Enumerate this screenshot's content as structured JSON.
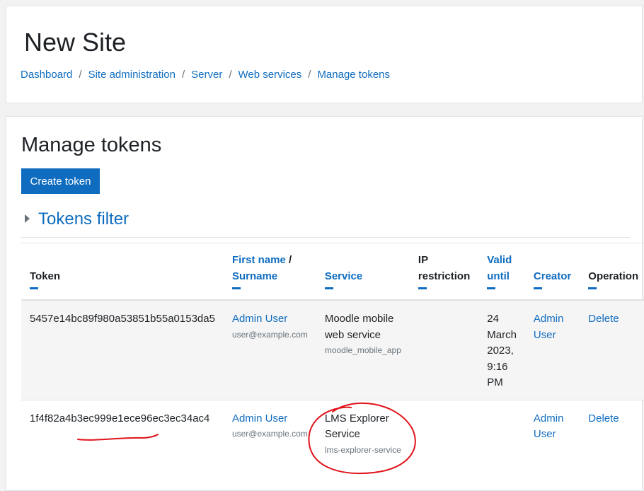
{
  "header": {
    "site_title": "New Site",
    "breadcrumb": [
      "Dashboard",
      "Site administration",
      "Server",
      "Web services",
      "Manage tokens"
    ]
  },
  "main": {
    "heading": "Manage tokens",
    "create_button": "Create token",
    "filter_title": "Tokens filter"
  },
  "table": {
    "columns": {
      "token": "Token",
      "first_name": "First name",
      "name_sep": " / ",
      "surname": "Surname",
      "service": "Service",
      "ip_restriction": "IP restriction",
      "valid_until": "Valid until",
      "creator": "Creator",
      "operation": "Operation"
    },
    "rows": [
      {
        "token": "5457e14bc89f980a53851b55a0153da5",
        "user": "Admin User",
        "email": "user@example.com",
        "service": "Moodle mobile web service",
        "service_short": "moodle_mobile_app",
        "ip": "",
        "valid_until": "24 March 2023, 9:16 PM",
        "creator": "Admin User",
        "operation": "Delete"
      },
      {
        "token": "1f4f82a4b3ec999e1ece96ec3ec34ac4",
        "user": "Admin User",
        "email": "user@example.com",
        "service": "LMS Explorer Service",
        "service_short": "lms-explorer-service",
        "ip": "",
        "valid_until": "",
        "creator": "Admin User",
        "operation": "Delete"
      }
    ]
  },
  "colors": {
    "link": "#0f6cbf",
    "annotation": "#e0131b"
  }
}
